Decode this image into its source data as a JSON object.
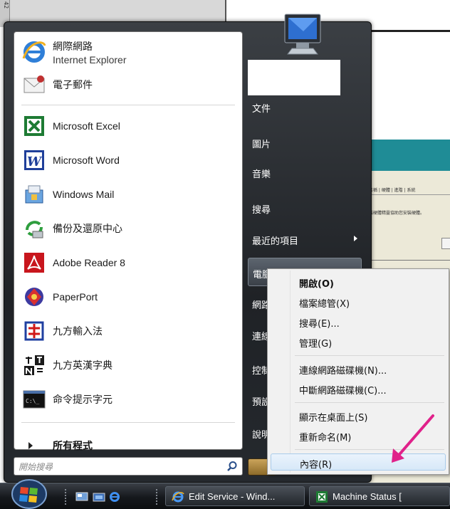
{
  "background": {
    "ruler_text": "42",
    "dialog_tabs": "名稱 | 硬體 | 進階 | 系統",
    "dialog_text": "裝硬體精靈協助您安裝硬體。"
  },
  "start_menu": {
    "pinned": [
      {
        "name": "網際網路",
        "sub": "Internet Explorer",
        "icon": "internet-explorer-icon"
      },
      {
        "name": "電子郵件",
        "icon": "email-icon"
      }
    ],
    "recent": [
      {
        "name": "Microsoft Excel",
        "icon": "excel-icon"
      },
      {
        "name": "Microsoft Word",
        "icon": "word-icon"
      },
      {
        "name": "Windows Mail",
        "icon": "windows-mail-icon"
      },
      {
        "name": "備份及還原中心",
        "icon": "backup-icon"
      },
      {
        "name": "Adobe Reader 8",
        "icon": "adobe-reader-icon"
      },
      {
        "name": "PaperPort",
        "icon": "paperport-icon"
      },
      {
        "name": "九方輸入法",
        "icon": "input-method-icon"
      },
      {
        "name": "九方英漢字典",
        "icon": "dictionary-icon"
      },
      {
        "name": "命令提示字元",
        "icon": "command-prompt-icon"
      }
    ],
    "all_programs": "所有程式",
    "search_placeholder": "開始搜尋",
    "right_items": [
      {
        "label": "文件"
      },
      {
        "label": "圖片"
      },
      {
        "label": "音樂"
      },
      {
        "label": "搜尋"
      },
      {
        "label": "最近的項目"
      },
      {
        "label": "電腦"
      },
      {
        "label": "網路"
      },
      {
        "label": "連線"
      },
      {
        "label": "控制"
      },
      {
        "label": "預設"
      },
      {
        "label": "說明"
      }
    ]
  },
  "context_menu": {
    "items": [
      {
        "label": "開啟(O)"
      },
      {
        "label": "檔案總管(X)"
      },
      {
        "label": "搜尋(E)..."
      },
      {
        "label": "管理(G)"
      },
      {
        "label": "連線網路磁碟機(N)..."
      },
      {
        "label": "中斷網路磁碟機(C)..."
      },
      {
        "label": "顯示在桌面上(S)"
      },
      {
        "label": "重新命名(M)"
      },
      {
        "label": "內容(R)"
      }
    ]
  },
  "taskbar": {
    "buttons": [
      {
        "label": "Edit Service - Wind..."
      },
      {
        "label": "Machine Status  ["
      }
    ]
  },
  "colors": {
    "annotation_arrow": "#e0218a",
    "menu_dark": "#1f2226",
    "hover_blue": "#d7e8f8"
  }
}
